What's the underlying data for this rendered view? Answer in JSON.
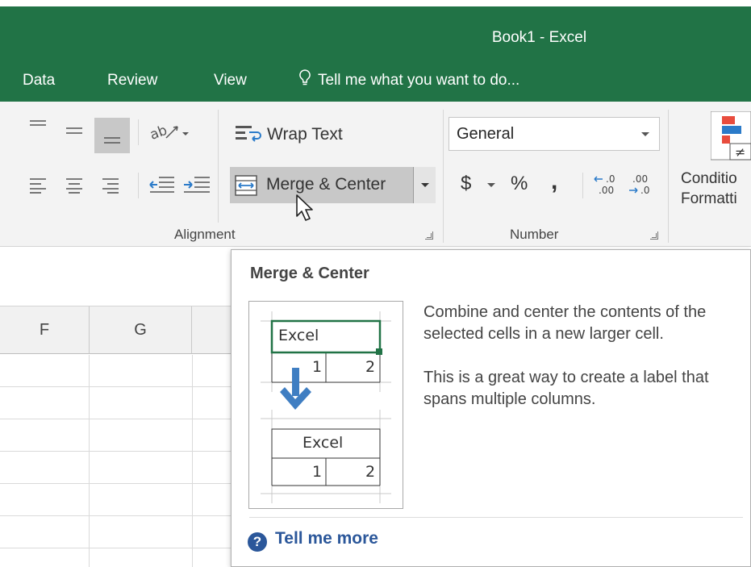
{
  "window": {
    "title": "Book1 - Excel"
  },
  "tabs": [
    "Data",
    "Review",
    "View"
  ],
  "tell_me": {
    "text": "Tell me what you want to do...",
    "icon": "lightbulb-icon"
  },
  "ribbon": {
    "alignment": {
      "label": "Alignment",
      "wrap_text_label": "Wrap Text",
      "merge_label": "Merge & Center"
    },
    "number": {
      "label": "Number",
      "format_value": "General",
      "currency_symbol": "$",
      "percent_symbol": "%",
      "comma_symbol": ","
    },
    "styles": {
      "conditional_formatting_label_line1": "Conditio",
      "conditional_formatting_label_line2": "Formatti"
    }
  },
  "columns": [
    "F",
    "G"
  ],
  "tooltip": {
    "title": "Merge & Center",
    "description_1": "Combine and center the contents of the selected cells in a new larger cell.",
    "description_2": "This is a great way to create a label that spans multiple columns.",
    "link": "Tell me more",
    "preview": {
      "before_label": "Excel",
      "before_values": [
        "1",
        "2"
      ],
      "after_label": "Excel",
      "after_values": [
        "1",
        "2"
      ]
    }
  },
  "colors": {
    "accent": "#217346",
    "selection": "#217346",
    "arrow": "#3f7ec2",
    "link": "#2b579a"
  }
}
